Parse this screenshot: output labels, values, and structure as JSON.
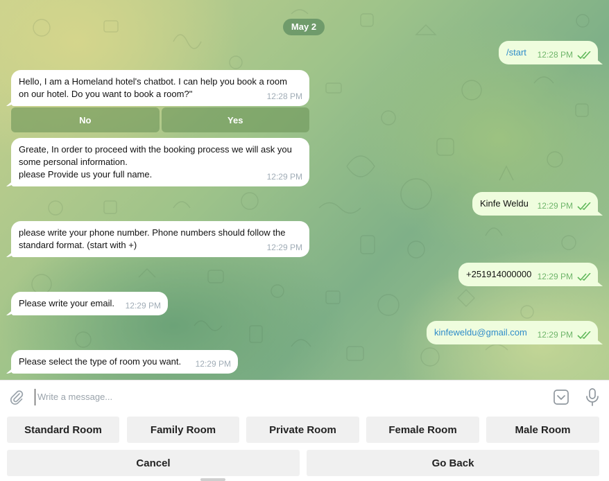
{
  "chat": {
    "date": "May 2",
    "messages": [
      {
        "dir": "out",
        "text": "/start",
        "time": "12:28 PM",
        "link": true
      },
      {
        "dir": "in",
        "text": "Hello, I am a Homeland hotel's chatbot. I can help you book a room\non our hotel. Do you want to book a room?\"",
        "time": "12:28 PM"
      },
      {
        "dir": "in",
        "text": "Greate, In order to proceed with the booking process we will ask you\nsome personal information.\nplease Provide us your full name.",
        "time": "12:29 PM"
      },
      {
        "dir": "out",
        "text": "Kinfe Weldu",
        "time": "12:29 PM"
      },
      {
        "dir": "in",
        "text": "please write your phone number. Phone numbers should follow the\nstandard format. (start with +)",
        "time": "12:29 PM"
      },
      {
        "dir": "out",
        "text": "+251914000000",
        "time": "12:29 PM"
      },
      {
        "dir": "in",
        "text": "Please write your email.",
        "time": "12:29 PM"
      },
      {
        "dir": "out",
        "text": "kinfeweldu@gmail.com",
        "time": "12:29 PM",
        "link": true
      },
      {
        "dir": "in",
        "text": "Please select the type of room you want.",
        "time": "12:29 PM"
      }
    ],
    "inline_keyboard": [
      "No",
      "Yes"
    ]
  },
  "composer": {
    "placeholder": "Write a message...",
    "icons": [
      "paperclip-icon",
      "bot-keyboard-icon",
      "microphone-icon"
    ]
  },
  "reply_keyboard": {
    "row1": [
      "Standard Room",
      "Family Room",
      "Private Room",
      "Female Room",
      "Male Room"
    ],
    "row2": [
      "Cancel",
      "Go Back"
    ]
  },
  "colors": {
    "incoming_bubble": "#ffffff",
    "outgoing_bubble": "#effdde",
    "outgoing_time": "#6fb56a",
    "link": "#2f8cc9",
    "date_pill": "#5e8c60",
    "reply_button": "#f0f0f0"
  }
}
